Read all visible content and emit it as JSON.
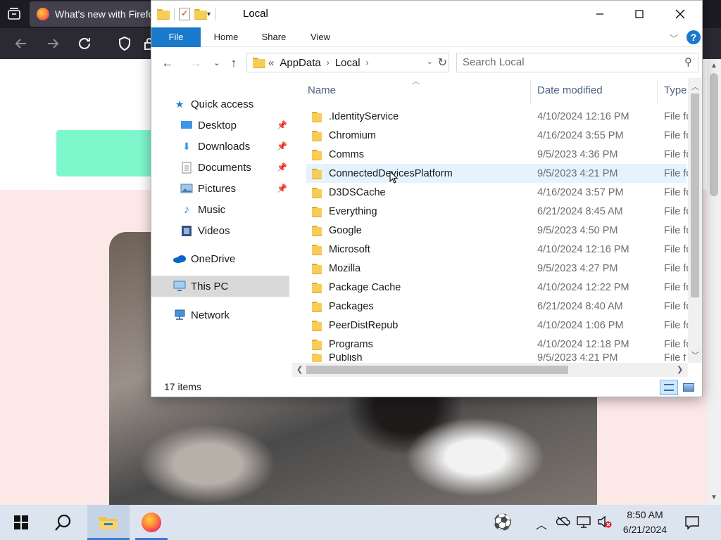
{
  "firefox": {
    "tab_title": "What's new with Firefox"
  },
  "explorer": {
    "title": "Local",
    "ribbon_tabs": [
      "File",
      "Home",
      "Share",
      "View"
    ],
    "help": "?",
    "address": {
      "overflow": "«",
      "crumbs": [
        "AppData",
        "Local"
      ]
    },
    "search_placeholder": "Search Local",
    "nav_pane": {
      "quick_access": "Quick access",
      "items": [
        {
          "label": "Desktop",
          "pinned": true
        },
        {
          "label": "Downloads",
          "pinned": true
        },
        {
          "label": "Documents",
          "pinned": true
        },
        {
          "label": "Pictures",
          "pinned": true
        },
        {
          "label": "Music",
          "pinned": false
        },
        {
          "label": "Videos",
          "pinned": false
        }
      ],
      "onedrive": "OneDrive",
      "this_pc": "This PC",
      "network": "Network"
    },
    "columns": {
      "name": "Name",
      "date_modified": "Date modified",
      "type": "Type"
    },
    "files": [
      {
        "name": ".IdentityService",
        "date": "4/10/2024 12:16 PM",
        "type": "File fo"
      },
      {
        "name": "Chromium",
        "date": "4/16/2024 3:55 PM",
        "type": "File fo"
      },
      {
        "name": "Comms",
        "date": "9/5/2023 4:36 PM",
        "type": "File fo"
      },
      {
        "name": "ConnectedDevicesPlatform",
        "date": "9/5/2023 4:21 PM",
        "type": "File fo"
      },
      {
        "name": "D3DSCache",
        "date": "4/16/2024 3:57 PM",
        "type": "File fo"
      },
      {
        "name": "Everything",
        "date": "6/21/2024 8:45 AM",
        "type": "File fo"
      },
      {
        "name": "Google",
        "date": "9/5/2023 4:50 PM",
        "type": "File fo"
      },
      {
        "name": "Microsoft",
        "date": "4/10/2024 12:16 PM",
        "type": "File fo"
      },
      {
        "name": "Mozilla",
        "date": "9/5/2023 4:27 PM",
        "type": "File fo"
      },
      {
        "name": "Package Cache",
        "date": "4/10/2024 12:22 PM",
        "type": "File fo"
      },
      {
        "name": "Packages",
        "date": "6/21/2024 8:40 AM",
        "type": "File fo"
      },
      {
        "name": "PeerDistRepub",
        "date": "4/10/2024 1:06 PM",
        "type": "File fo"
      },
      {
        "name": "Programs",
        "date": "4/10/2024 12:18 PM",
        "type": "File fo"
      },
      {
        "name": "Publish",
        "date": "9/5/2023 4:21 PM",
        "type": "File fo"
      }
    ],
    "hovered_row": 3,
    "status_count": "17 items"
  },
  "taskbar": {
    "time": "8:50 AM",
    "date": "6/21/2024"
  },
  "colors": {
    "accent": "#1979ca",
    "hover_row": "#e5f3ff",
    "taskbar": "#dce4ef"
  }
}
